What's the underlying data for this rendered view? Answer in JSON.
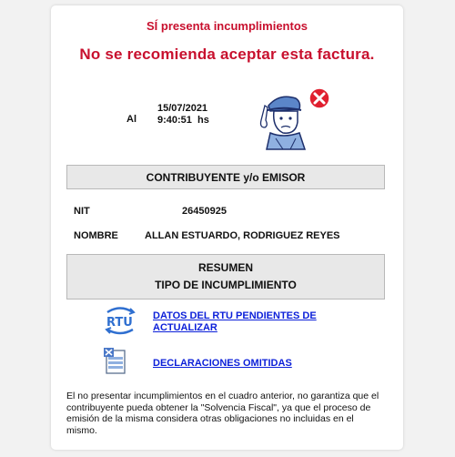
{
  "header": {
    "status_line": "SÍ presenta incumplimientos",
    "headline": "No se recomienda aceptar esta factura."
  },
  "timestamp": {
    "al_label": "Al",
    "date": "15/07/2021",
    "time": "9:40:51  hs"
  },
  "illustration": {
    "icon": "worried-person-with-error-icon",
    "accent_color": "#e0202f"
  },
  "contribuyente": {
    "section_title": "CONTRIBUYENTE y/o EMISOR",
    "nit_label": "NIT",
    "nit_value": "26450925",
    "nombre_label": "NOMBRE",
    "nombre_value": "ALLAN ESTUARDO, RODRIGUEZ REYES"
  },
  "resumen": {
    "title_line1": "RESUMEN",
    "title_line2": "TIPO DE INCUMPLIMIENTO",
    "items": [
      {
        "icon": "rtu-icon",
        "label": "DATOS DEL RTU PENDIENTES DE ACTUALIZAR"
      },
      {
        "icon": "declaraciones-omitidas-icon",
        "label": "DECLARACIONES OMITIDAS"
      }
    ]
  },
  "disclaimer": "El no presentar incumplimientos en el cuadro anterior, no garantiza que el contribuyente pueda obtener la \"Solvencia Fiscal\", ya que el proceso de emisión de la misma considera otras obligaciones no incluidas en el mismo.",
  "colors": {
    "alert_red": "#c8102e",
    "link_blue": "#0b1fd9",
    "section_bg": "#e8e8e8"
  }
}
